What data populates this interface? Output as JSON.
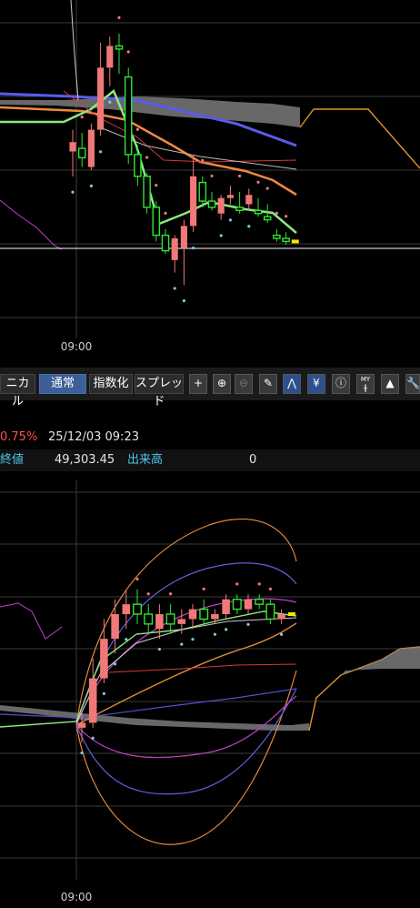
{
  "toolbar": {
    "technical_label": "ニカル",
    "modes": [
      {
        "label": "通常",
        "active": true
      },
      {
        "label": "指数化",
        "active": false
      },
      {
        "label": "スプレッド",
        "active": false
      }
    ],
    "icons": [
      "plus-icon",
      "zoom-in-icon",
      "zoom-out-icon",
      "pencil-icon",
      "chart-pattern-icon",
      "yen-icon",
      "info-icon",
      "my-indicator-icon",
      "area-chart-icon",
      "settings-icon"
    ]
  },
  "quote": {
    "change_pct": "0.75%",
    "datetime": "25/12/03  09:23",
    "close_label": "終値",
    "close_value": "49,303.45",
    "volume_label": "出来高",
    "volume_value": "0"
  },
  "colors": {
    "background": "#000000",
    "grid": "#3a3a3a",
    "up_candle": "#f07878",
    "down_candle": "#2ee82e",
    "cloud": "#777777",
    "change_pct": "#ff5050",
    "volume_label": "#4ec4ea",
    "last_candle": "#f0e600"
  },
  "chart_data": [
    {
      "type": "candlestick",
      "x_tick_labels": [
        "09:00"
      ],
      "candles": [
        {
          "o": 49350,
          "h": 49420,
          "l": 49270,
          "c": 49380
        },
        {
          "o": 49360,
          "h": 49410,
          "l": 49300,
          "c": 49330
        },
        {
          "o": 49300,
          "h": 49440,
          "l": 49290,
          "c": 49420
        },
        {
          "o": 49420,
          "h": 49700,
          "l": 49400,
          "c": 49620
        },
        {
          "o": 49620,
          "h": 49720,
          "l": 49560,
          "c": 49690
        },
        {
          "o": 49690,
          "h": 49730,
          "l": 49600,
          "c": 49680
        },
        {
          "o": 49590,
          "h": 49620,
          "l": 49310,
          "c": 49340
        },
        {
          "o": 49340,
          "h": 49370,
          "l": 49240,
          "c": 49270
        },
        {
          "o": 49270,
          "h": 49280,
          "l": 49150,
          "c": 49170
        },
        {
          "o": 49170,
          "h": 49190,
          "l": 49060,
          "c": 49080
        },
        {
          "o": 49080,
          "h": 49100,
          "l": 49020,
          "c": 49030
        },
        {
          "o": 49000,
          "h": 49080,
          "l": 48960,
          "c": 49070
        },
        {
          "o": 49040,
          "h": 49130,
          "l": 48920,
          "c": 49110
        },
        {
          "o": 49110,
          "h": 49340,
          "l": 49090,
          "c": 49270
        },
        {
          "o": 49250,
          "h": 49270,
          "l": 49170,
          "c": 49190
        },
        {
          "o": 49190,
          "h": 49220,
          "l": 49160,
          "c": 49170
        },
        {
          "o": 49150,
          "h": 49210,
          "l": 49130,
          "c": 49200
        },
        {
          "o": 49200,
          "h": 49240,
          "l": 49180,
          "c": 49210
        },
        {
          "o": 49170,
          "h": 49220,
          "l": 49150,
          "c": 49160
        },
        {
          "o": 49180,
          "h": 49230,
          "l": 49160,
          "c": 49210
        },
        {
          "o": 49160,
          "h": 49200,
          "l": 49140,
          "c": 49150
        },
        {
          "o": 49140,
          "h": 49180,
          "l": 49120,
          "c": 49130
        },
        {
          "o": 49080,
          "h": 49100,
          "l": 49060,
          "c": 49070
        },
        {
          "o": 49070,
          "h": 49090,
          "l": 49050,
          "c": 49060
        }
      ],
      "last_price": 49060
    },
    {
      "type": "candlestick",
      "x_tick_labels": [
        "09:00"
      ],
      "candles": [
        {
          "o": 49200,
          "h": 49230,
          "l": 49170,
          "c": 49210
        },
        {
          "o": 49210,
          "h": 49340,
          "l": 49200,
          "c": 49300
        },
        {
          "o": 49300,
          "h": 49420,
          "l": 49290,
          "c": 49380
        },
        {
          "o": 49380,
          "h": 49460,
          "l": 49350,
          "c": 49430
        },
        {
          "o": 49430,
          "h": 49480,
          "l": 49400,
          "c": 49450
        },
        {
          "o": 49450,
          "h": 49480,
          "l": 49410,
          "c": 49430
        },
        {
          "o": 49430,
          "h": 49450,
          "l": 49390,
          "c": 49410
        },
        {
          "o": 49400,
          "h": 49450,
          "l": 49380,
          "c": 49430
        },
        {
          "o": 49430,
          "h": 49450,
          "l": 49390,
          "c": 49410
        },
        {
          "o": 49410,
          "h": 49440,
          "l": 49390,
          "c": 49420
        },
        {
          "o": 49420,
          "h": 49450,
          "l": 49400,
          "c": 49440
        },
        {
          "o": 49440,
          "h": 49460,
          "l": 49410,
          "c": 49420
        },
        {
          "o": 49420,
          "h": 49440,
          "l": 49410,
          "c": 49430
        },
        {
          "o": 49430,
          "h": 49470,
          "l": 49420,
          "c": 49460
        },
        {
          "o": 49460,
          "h": 49470,
          "l": 49430,
          "c": 49440
        },
        {
          "o": 49440,
          "h": 49470,
          "l": 49430,
          "c": 49460
        },
        {
          "o": 49460,
          "h": 49470,
          "l": 49440,
          "c": 49450
        },
        {
          "o": 49450,
          "h": 49460,
          "l": 49410,
          "c": 49420
        },
        {
          "o": 49420,
          "h": 49440,
          "l": 49410,
          "c": 49430
        }
      ],
      "last_price": 49430
    }
  ]
}
